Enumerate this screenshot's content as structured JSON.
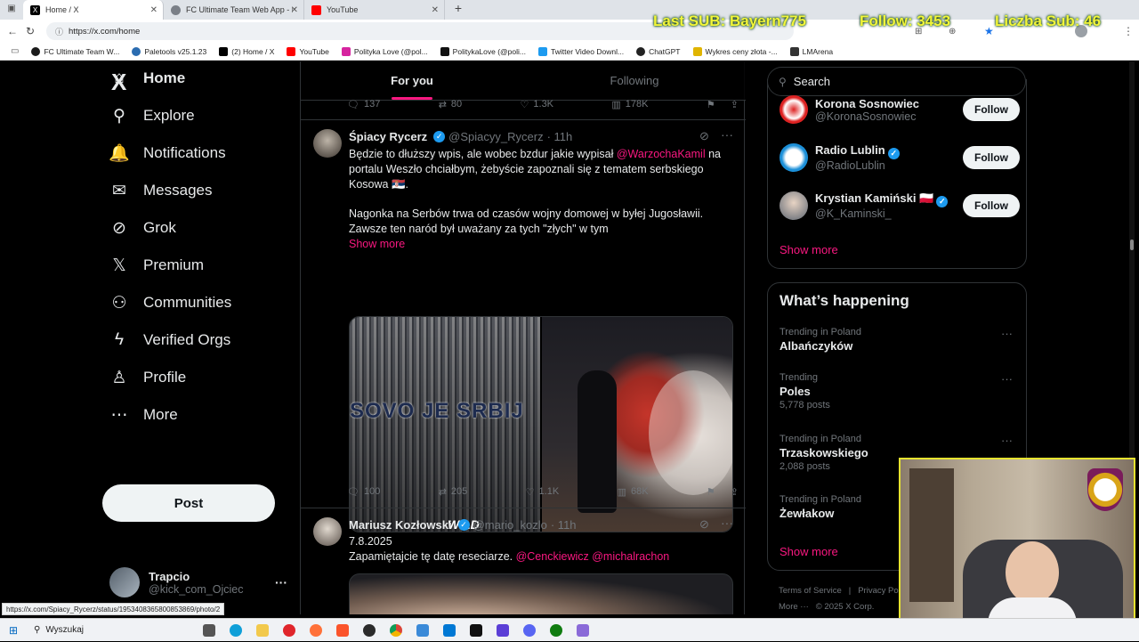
{
  "browser": {
    "tabs": [
      {
        "title": "Home / X",
        "color": "#000000",
        "active": true
      },
      {
        "title": "FC Ultimate Team Web App - EA S",
        "color": "#7a7f87",
        "active": false
      },
      {
        "title": "YouTube",
        "color": "#ff0000",
        "active": false
      }
    ],
    "new_tab": "+",
    "url": "https://x.com/home",
    "bookmarks": [
      {
        "label": "FC Ultimate Team W...",
        "color": "#1a1a1a"
      },
      {
        "label": "Paletools v25.1.23",
        "color": "#2b6cb0"
      },
      {
        "label": "(2) Home / X",
        "color": "#000000"
      },
      {
        "label": "YouTube",
        "color": "#ff0000"
      },
      {
        "label": "Polityka Love (@pol...",
        "color": "#d6249f"
      },
      {
        "label": "PolitykaLove (@poli...",
        "color": "#111111"
      },
      {
        "label": "Twitter Video Downl...",
        "color": "#1d9bf0"
      },
      {
        "label": "ChatGPT",
        "color": "#222222"
      },
      {
        "label": "Wykres ceny złota -...",
        "color": "#e0b400"
      },
      {
        "label": "LMArena",
        "color": "#333333"
      }
    ],
    "status_url": "https://x.com/Spiacy_Rycerz/status/1953408365800853869/photo/2"
  },
  "overlay": {
    "last_sub": "Last SUB: Bayern775",
    "follow": "Follow: 3453",
    "subs": "Liczba Sub: 46"
  },
  "nav": {
    "logo": "X",
    "items": [
      {
        "label": "Home",
        "icon": "home-icon",
        "glyph": "⌂"
      },
      {
        "label": "Explore",
        "icon": "search-icon",
        "glyph": "⚲"
      },
      {
        "label": "Notifications",
        "icon": "bell-icon",
        "glyph": "🔔"
      },
      {
        "label": "Messages",
        "icon": "envelope-icon",
        "glyph": "✉"
      },
      {
        "label": "Grok",
        "icon": "grok-icon",
        "glyph": "⊘"
      },
      {
        "label": "Premium",
        "icon": "x-logo-icon",
        "glyph": "𝕏"
      },
      {
        "label": "Communities",
        "icon": "people-icon",
        "glyph": "⚇"
      },
      {
        "label": "Verified Orgs",
        "icon": "lightning-icon",
        "glyph": "ϟ"
      },
      {
        "label": "Profile",
        "icon": "person-icon",
        "glyph": "♙"
      },
      {
        "label": "More",
        "icon": "more-circle-icon",
        "glyph": "⋯"
      }
    ],
    "post_label": "Post",
    "account": {
      "name": "Trapcio",
      "handle": "@kick_com_Ojciec",
      "more": "···"
    }
  },
  "feed": {
    "tabs": [
      {
        "label": "For you"
      },
      {
        "label": "Following"
      }
    ],
    "top_actions": {
      "replies": "137",
      "reposts": "80",
      "likes": "1.3K",
      "views": "178K"
    },
    "tweet1": {
      "name": "Śpiacy Rycerz",
      "handle": "@Spiacyy_Rycerz",
      "time": "· 11h",
      "text_a": "Będzie to dłuższy wpis, ale wobec bzdur jakie wypisał ",
      "mention": "@WarzochaKamil",
      "text_b": " na portalu Weszło chciałbym, żebyście zapoznali się z tematem serbskiego Kosowa 🇷🇸.",
      "text_c": "Nagonka na Serbów trwa od czasów wojny domowej w byłej Jugosławii. Zawsze ten naród był uważany za tych \"złych\" w tym",
      "show_more": "Show more",
      "banner_text": "SOVO JE SRBIJ",
      "banner_text2": "WILD",
      "actions": {
        "replies": "100",
        "reposts": "205",
        "likes": "1.1K",
        "views": "68K"
      }
    },
    "tweet2": {
      "name": "Mariusz Kozłowski",
      "handle": "@mario_kozlo",
      "time": "· 11h",
      "line1": "7.8.2025",
      "text": "Zapamiętajcie tę datę reseciarze. ",
      "mentions": "@Cenckiewicz @michalrachon"
    }
  },
  "sidebar": {
    "search_placeholder": "Search",
    "who_to_follow": [
      {
        "name": "Korona Sosnowiec",
        "handle": "@KoronaSosnowiec",
        "verified": false,
        "follow": "Follow"
      },
      {
        "name": "Radio Lublin",
        "handle": "@RadioLublin",
        "verified": true,
        "follow": "Follow"
      },
      {
        "name": "Krystian Kamiński 🇵🇱",
        "handle": "@K_Kaminski_",
        "verified": true,
        "follow": "Follow"
      }
    ],
    "show_more": "Show more",
    "whats_happening_title": "What’s happening",
    "trends": [
      {
        "context": "Trending in Poland",
        "topic": "Albańczyków",
        "count": ""
      },
      {
        "context": "Trending",
        "topic": "Poles",
        "count": "5,778 posts"
      },
      {
        "context": "Trending in Poland",
        "topic": "Trzaskowskiego",
        "count": "2,088 posts"
      },
      {
        "context": "Trending in Poland",
        "topic": "Żewłakow",
        "count": ""
      }
    ],
    "trends_show_more": "Show more",
    "footer": {
      "tos": "Terms of Service",
      "sep": "|",
      "privacy": "Privacy Po",
      "more": "More ···",
      "copy": "© 2025 X Corp."
    }
  },
  "taskbar": {
    "search": "Wyszukaj"
  },
  "colors": {
    "accent": "#f91880",
    "verified": "#1d9bf0",
    "bg": "#000000",
    "border": "#2f3336",
    "overlay": "#f3f53a"
  }
}
